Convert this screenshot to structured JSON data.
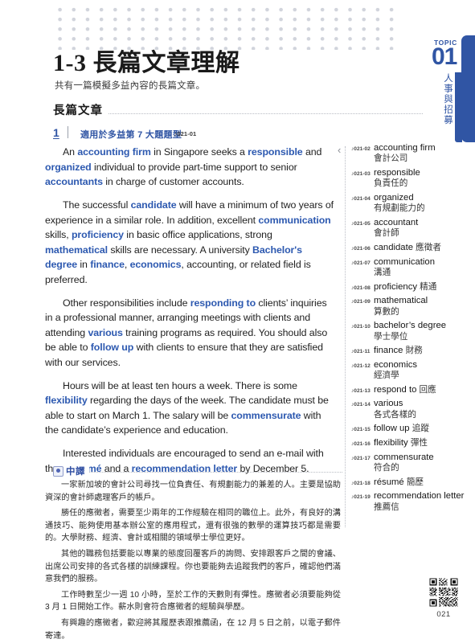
{
  "topic": {
    "word": "TOPIC",
    "number": "01",
    "vertical_label": "人事與招募",
    "accent_color": "#3055a4"
  },
  "header": {
    "title": "1-3 長篇文章理解",
    "subtitle": "共有一篇模擬多益內容的長篇文章。",
    "section_label": "長篇文章"
  },
  "item": {
    "number": "1",
    "description": "適用於多益第 7 大題題型",
    "audio_note": "♪",
    "audio_code": "021-01"
  },
  "passage": {
    "paragraphs": [
      [
        {
          "t": "An ",
          "k": false
        },
        {
          "t": "accounting firm",
          "k": true
        },
        {
          "t": " in Singapore seeks a ",
          "k": false
        },
        {
          "t": "responsible",
          "k": true
        },
        {
          "t": " and ",
          "k": false
        },
        {
          "t": "organized",
          "k": true
        },
        {
          "t": " individual to provide part-time support to senior ",
          "k": false
        },
        {
          "t": "accountants",
          "k": true
        },
        {
          "t": " in charge of customer accounts.",
          "k": false
        }
      ],
      [
        {
          "t": "The successful ",
          "k": false
        },
        {
          "t": "candidate",
          "k": true
        },
        {
          "t": " will have a minimum of two years of experience in a similar role. In addition, excellent ",
          "k": false
        },
        {
          "t": "communication",
          "k": true
        },
        {
          "t": " skills, ",
          "k": false
        },
        {
          "t": "proficiency",
          "k": true
        },
        {
          "t": " in basic office applications, strong ",
          "k": false
        },
        {
          "t": "mathematical",
          "k": true
        },
        {
          "t": " skills are necessary. A university ",
          "k": false
        },
        {
          "t": "Bachelor's degree",
          "k": true
        },
        {
          "t": " in ",
          "k": false
        },
        {
          "t": "finance",
          "k": true
        },
        {
          "t": ", ",
          "k": false
        },
        {
          "t": "economics",
          "k": true
        },
        {
          "t": ", accounting, or related field is preferred.",
          "k": false
        }
      ],
      [
        {
          "t": "Other responsibilities include ",
          "k": false
        },
        {
          "t": "responding to",
          "k": true
        },
        {
          "t": " clients’ inquiries in a professional manner, arranging meetings with clients and attending ",
          "k": false
        },
        {
          "t": "various",
          "k": true
        },
        {
          "t": " training programs as required. You should also be able to ",
          "k": false
        },
        {
          "t": "follow up",
          "k": true
        },
        {
          "t": " with clients to ensure that they are satisfied with our services.",
          "k": false
        }
      ],
      [
        {
          "t": "Hours will be at least ten hours a week. There is some ",
          "k": false
        },
        {
          "t": "flexibility",
          "k": true
        },
        {
          "t": " regarding the days of the week. The candidate must be able to start on March 1. The salary will be ",
          "k": false
        },
        {
          "t": "commensurate",
          "k": true
        },
        {
          "t": " with the candidate’s experience and education.",
          "k": false
        }
      ],
      [
        {
          "t": "Interested individuals are encouraged to send an e-mail with their ",
          "k": false
        },
        {
          "t": "résumé",
          "k": true
        },
        {
          "t": " and a ",
          "k": false
        },
        {
          "t": "recommendation letter",
          "k": true
        },
        {
          "t": " by December 5.",
          "k": false
        }
      ]
    ],
    "bracket_marker": "‹"
  },
  "vocabulary": [
    {
      "code": "♪021-02",
      "en": "accounting firm",
      "zh": "會計公司",
      "inline": false
    },
    {
      "code": "♪021-03",
      "en": "responsible",
      "zh": "負責任的",
      "inline": false
    },
    {
      "code": "♪021-04",
      "en": "organized",
      "zh": "有規劃能力的",
      "inline": false
    },
    {
      "code": "♪021-05",
      "en": "accountant",
      "zh": "會計師",
      "inline": false
    },
    {
      "code": "♪021-06",
      "en": "candidate",
      "zh": "應徵者",
      "inline": true
    },
    {
      "code": "♪021-07",
      "en": "communication",
      "zh": "溝通",
      "inline": false
    },
    {
      "code": "♪021-08",
      "en": "proficiency",
      "zh": "精通",
      "inline": true
    },
    {
      "code": "♪021-09",
      "en": "mathematical",
      "zh": "算數的",
      "inline": false
    },
    {
      "code": "♪021-10",
      "en": "bachelor’s degree",
      "zh": "學士學位",
      "inline": false
    },
    {
      "code": "♪021-11",
      "en": "finance",
      "zh": "財務",
      "inline": true
    },
    {
      "code": "♪021-12",
      "en": "economics",
      "zh": "經濟學",
      "inline": false
    },
    {
      "code": "♪021-13",
      "en": "respond to",
      "zh": "回應",
      "inline": true
    },
    {
      "code": "♪021-14",
      "en": "various",
      "zh": "各式各樣的",
      "inline": false
    },
    {
      "code": "♪021-15",
      "en": "follow up",
      "zh": "追蹤",
      "inline": true
    },
    {
      "code": "♪021-16",
      "en": "flexibility",
      "zh": "彈性",
      "inline": true
    },
    {
      "code": "♪021-17",
      "en": "commensurate",
      "zh": "符合的",
      "inline": false
    },
    {
      "code": "♪021-18",
      "en": "résumé",
      "zh": "簡歷",
      "inline": true
    },
    {
      "code": "♪021-19",
      "en": "recommendation letter",
      "zh": "推薦信",
      "inline": true
    }
  ],
  "translation": {
    "badge_label": "中譯",
    "paragraphs": [
      "一家新加坡的會計公司尋找一位負責任、有規劃能力的兼差的人。主要是協助資深的會計師處理客戶的帳戶。",
      "勝任的應徵者，需要至少兩年的工作經驗在相同的職位上。此外，有良好的溝通技巧、能夠使用基本辦公室的應用程式，還有很強的數學的運算技巧都是需要的。大學財務、經濟、會計或相關的領域學士學位更好。",
      "其他的職務包括要能以專業的態度回覆客戶的詢問、安排跟客戶之間的會議、出席公司安排的各式各樣的訓練課程。你也要能夠去追蹤我們的客戶，確認他們滿意我們的服務。",
      "工作時數至少一週 10 小時，至於工作的天數則有彈性。應徵者必須要能夠從 3 月 1 日開始工作。薪水則會符合應徵者的經驗與學歷。",
      "有興趣的應徵者，歡迎將其履歷表跟推薦函，在 12 月 5 日之前，以電子郵件寄達。"
    ]
  },
  "footer": {
    "page_number": "021",
    "qr_label": "qr-code"
  }
}
